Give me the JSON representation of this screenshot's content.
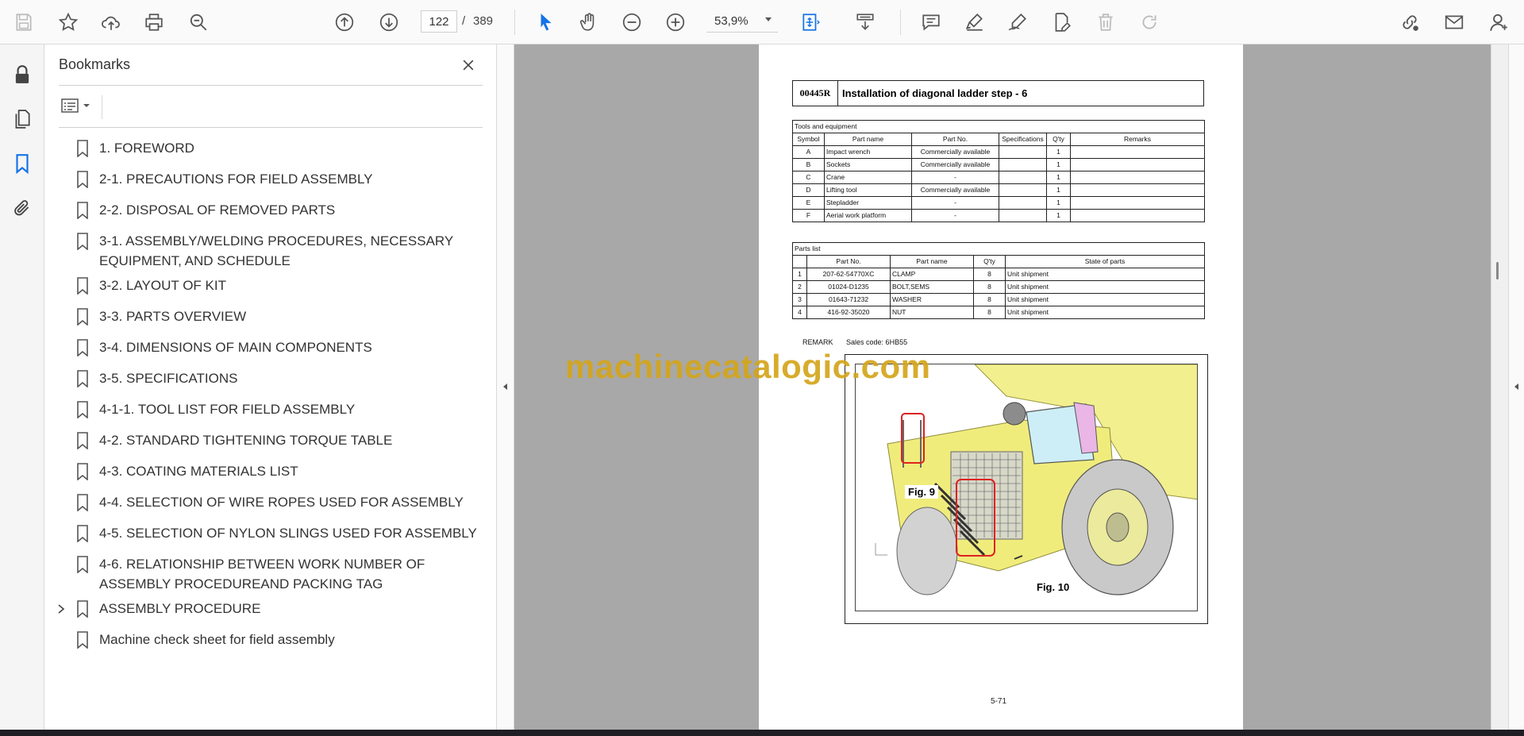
{
  "toolbar": {
    "icons": [
      "save-icon",
      "star-icon",
      "cloud-upload-icon",
      "print-icon",
      "search-icon",
      "page-up-icon",
      "page-down-icon",
      "select-arrow-icon",
      "hand-icon",
      "zoom-out-icon",
      "zoom-in-icon",
      "fit-page-icon",
      "scroll-mode-icon",
      "comment-icon",
      "highlight-icon",
      "sign-icon",
      "edit-icon",
      "delete-icon",
      "redo-icon",
      "share-link-icon",
      "email-icon",
      "account-icon"
    ],
    "current_page": "122",
    "page_separator": "/",
    "total_pages": "389",
    "zoom": "53,9%",
    "accent_color": "#1473e6"
  },
  "bookmarks": {
    "title": "Bookmarks",
    "items": [
      {
        "label": "1. FOREWORD",
        "expandable": false
      },
      {
        "label": "2-1. PRECAUTIONS FOR FIELD ASSEMBLY",
        "expandable": false
      },
      {
        "label": "2-2. DISPOSAL OF REMOVED PARTS",
        "expandable": false
      },
      {
        "label": "3-1. ASSEMBLY/WELDING PROCEDURES, NECESSARY EQUIPMENT, AND SCHEDULE",
        "expandable": false
      },
      {
        "label": "3-2. LAYOUT OF KIT",
        "expandable": false
      },
      {
        "label": "3-3. PARTS OVERVIEW",
        "expandable": false
      },
      {
        "label": "3-4. DIMENSIONS OF MAIN COMPONENTS",
        "expandable": false
      },
      {
        "label": "3-5. SPECIFICATIONS",
        "expandable": false
      },
      {
        "label": "4-1-1. TOOL LIST FOR FIELD ASSEMBLY",
        "expandable": false
      },
      {
        "label": "4-2. STANDARD TIGHTENING TORQUE TABLE",
        "expandable": false
      },
      {
        "label": "4-3. COATING MATERIALS LIST",
        "expandable": false
      },
      {
        "label": "4-4. SELECTION OF WIRE ROPES USED FOR ASSEMBLY",
        "expandable": false
      },
      {
        "label": "4-5. SELECTION OF NYLON SLINGS USED FOR ASSEMBLY",
        "expandable": false
      },
      {
        "label": "4-6. RELATIONSHIP BETWEEN WORK NUMBER OF ASSEMBLY PROCEDUREAND PACKING TAG",
        "expandable": false
      },
      {
        "label": "ASSEMBLY PROCEDURE",
        "expandable": true
      },
      {
        "label": "Machine check sheet for field assembly",
        "expandable": false
      }
    ]
  },
  "document": {
    "code": "00445R",
    "title": "Installation of diagonal ladder step - 6",
    "tools": {
      "caption": "Tools and equipment",
      "headers": [
        "Symbol",
        "Part name",
        "Part No.",
        "Specifications",
        "Q'ty",
        "Remarks"
      ],
      "rows": [
        [
          "A",
          "Impact wrench",
          "Commercially available",
          "",
          "1",
          ""
        ],
        [
          "B",
          "Sockets",
          "Commercially available",
          "",
          "1",
          ""
        ],
        [
          "C",
          "Crane",
          "-",
          "",
          "1",
          ""
        ],
        [
          "D",
          "Lifting tool",
          "Commercially available",
          "",
          "1",
          ""
        ],
        [
          "E",
          "Stepladder",
          "-",
          "",
          "1",
          ""
        ],
        [
          "F",
          "Aerial work platform",
          "-",
          "",
          "1",
          ""
        ]
      ]
    },
    "parts": {
      "caption": "Parts list",
      "headers": [
        "",
        "Part No.",
        "Part name",
        "Q'ty",
        "State of parts"
      ],
      "rows": [
        [
          "1",
          "207-62-54770XC",
          "CLAMP",
          "8",
          "Unit shipment"
        ],
        [
          "2",
          "01024-D1235",
          "BOLT,SEMS",
          "8",
          "Unit shipment"
        ],
        [
          "3",
          "01643-71232",
          "WASHER",
          "8",
          "Unit shipment"
        ],
        [
          "4",
          "416-92-35020",
          "NUT",
          "8",
          "Unit shipment"
        ]
      ]
    },
    "remark_label": "REMARK",
    "sales_code": "Sales code: 6HB55",
    "fig9_label": "Fig. 9",
    "fig10_label": "Fig. 10",
    "page_number": "5-71",
    "watermark": "machinecatalogic.com"
  }
}
